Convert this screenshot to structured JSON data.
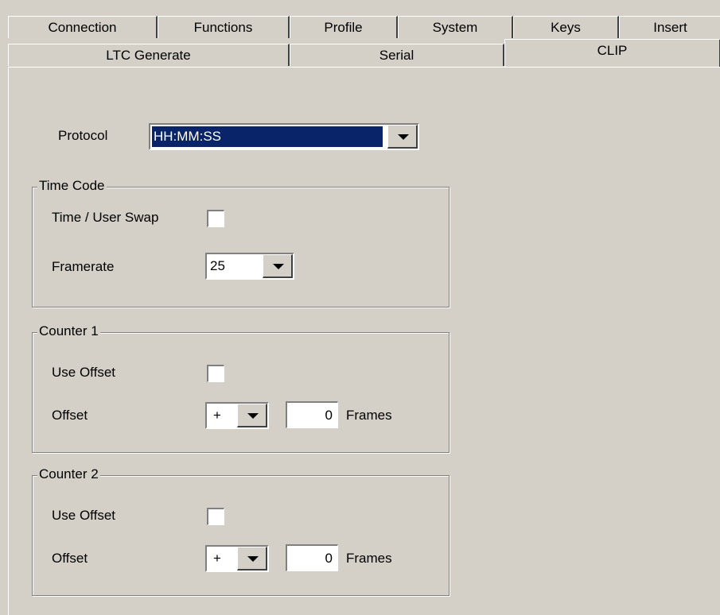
{
  "tabs_row1": [
    "Connection",
    "Functions",
    "Profile",
    "System",
    "Keys",
    "Insert"
  ],
  "tabs_row2": [
    "LTC Generate",
    "Serial",
    "CLIP"
  ],
  "active_tab": "CLIP",
  "protocol": {
    "label": "Protocol",
    "value": "HH:MM:SS"
  },
  "time_code": {
    "title": "Time Code",
    "swap_label": "Time / User Swap",
    "swap_checked": false,
    "framerate_label": "Framerate",
    "framerate_value": "25"
  },
  "counter1": {
    "title": "Counter 1",
    "use_offset_label": "Use Offset",
    "use_offset_checked": false,
    "offset_label": "Offset",
    "sign": "+",
    "value": "0",
    "unit": "Frames"
  },
  "counter2": {
    "title": "Counter 2",
    "use_offset_label": "Use Offset",
    "use_offset_checked": false,
    "offset_label": "Offset",
    "sign": "+",
    "value": "0",
    "unit": "Frames"
  },
  "colors": {
    "face": "#d4d0c8",
    "selection": "#0a246a"
  }
}
